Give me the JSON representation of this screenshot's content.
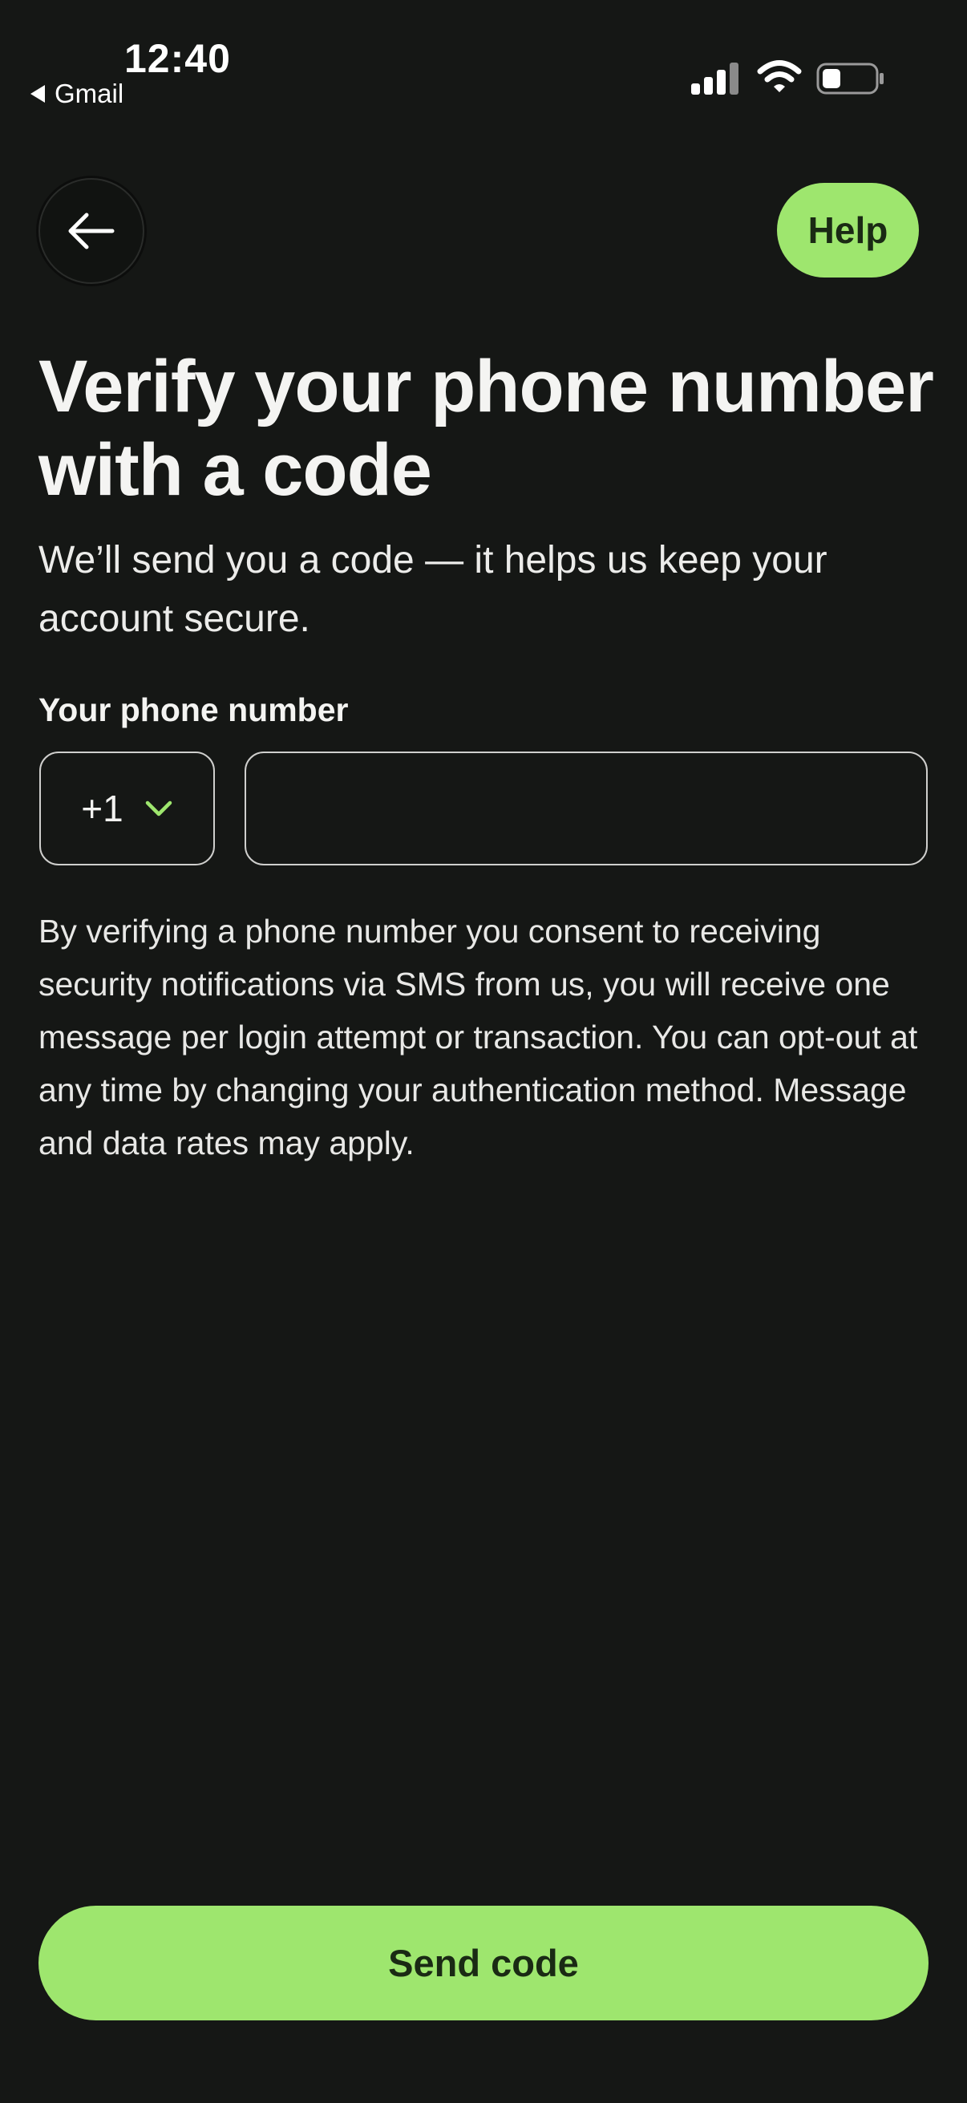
{
  "status_bar": {
    "time": "12:40",
    "back_app": "Gmail",
    "icons": [
      "signal-icon",
      "wifi-icon",
      "battery-icon"
    ]
  },
  "header": {
    "back_icon": "arrow-left-icon",
    "help_label": "Help"
  },
  "main": {
    "title": "Verify your phone number with a code",
    "subtitle": "We’ll send you a code — it helps us keep your account secure.",
    "phone_label": "Your phone number",
    "country_code": "+1",
    "phone_value": "",
    "phone_placeholder": "",
    "consent": "By verifying a phone number you consent to receiving security notifications via SMS from us, you will receive one message per login attempt or transaction. You can opt-out at any time by changing your authentication method. Message and data rates may apply."
  },
  "footer": {
    "send_label": "Send code"
  },
  "colors": {
    "background": "#151715",
    "accent": "#9ee66e",
    "accent_text": "#1a2a14",
    "text": "#f2f2f0",
    "border": "#cfcfcd"
  }
}
